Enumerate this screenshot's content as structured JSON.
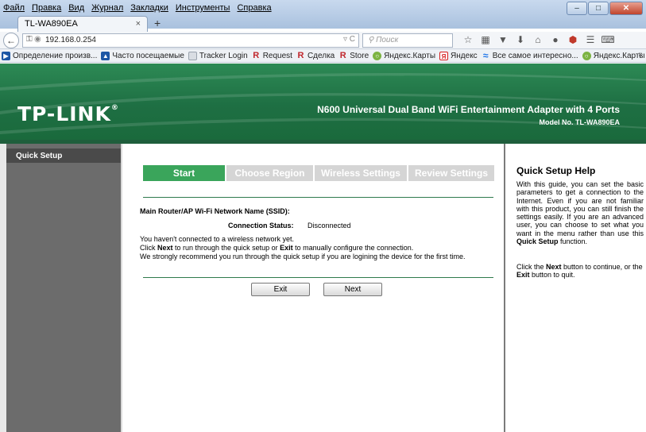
{
  "browser": {
    "menu": [
      "Файл",
      "Правка",
      "Вид",
      "Журнал",
      "Закладки",
      "Инструменты",
      "Справка"
    ],
    "tab_title": "TL-WA890EA",
    "tab_close": "×",
    "new_tab": "+",
    "url": "192.168.0.254",
    "search_placeholder": "Поиск",
    "bookmarks": [
      "Определение произв...",
      "Часто посещаемые",
      "Tracker Login",
      "Request",
      "Сделка",
      "Store",
      "Яндекс.Карты",
      "Яндекс",
      "Все самое интересно...",
      "Яндекс.Карты"
    ],
    "more": "»"
  },
  "header": {
    "logo": "TP-LINK",
    "logo_mark": "®",
    "product": "N600 Universal Dual Band WiFi Entertainment Adapter with 4 Ports",
    "model": "Model No. TL-WA890EA",
    "color": "#1e6f43"
  },
  "sidebar": {
    "items": [
      {
        "label": "Quick Setup"
      }
    ]
  },
  "wizard": {
    "steps": [
      {
        "label": "Start",
        "active": true
      },
      {
        "label": "Choose Region",
        "active": false
      },
      {
        "label": "Wireless Settings",
        "active": false
      },
      {
        "label": "Review Settings",
        "active": false
      }
    ],
    "active_color": "#3aa55b",
    "ssid_label": "Main Router/AP Wi-Fi Network Name (SSID):",
    "status_label": "Connection Status:",
    "status_value": "Disconnected",
    "msg1": "You haven't connected to a wireless network yet.",
    "msg2_pre": "Click ",
    "msg2_next": "Next",
    "msg2_mid": " to run through the quick setup or ",
    "msg2_exit": "Exit",
    "msg2_post": " to manually configure the connection.",
    "msg3": "We strongly recommend you run through the quick setup if you are logining the device for the first time.",
    "exit_label": "Exit",
    "next_label": "Next"
  },
  "help": {
    "title": "Quick Setup Help",
    "p1": "With this guide, you can set the basic parameters to get a connection to the Internet. Even if you are not familiar with this product, you can still finish the settings easily. If you are an advanced user, you can choose to set what you want in the menu rather than use this",
    "p1_bold": "Quick Setup",
    "p1_end": " function.",
    "p2_a": "Click the ",
    "p2_next": "Next",
    "p2_b": " button to continue, or the ",
    "p2_exit": "Exit",
    "p2_c": " button to quit."
  }
}
